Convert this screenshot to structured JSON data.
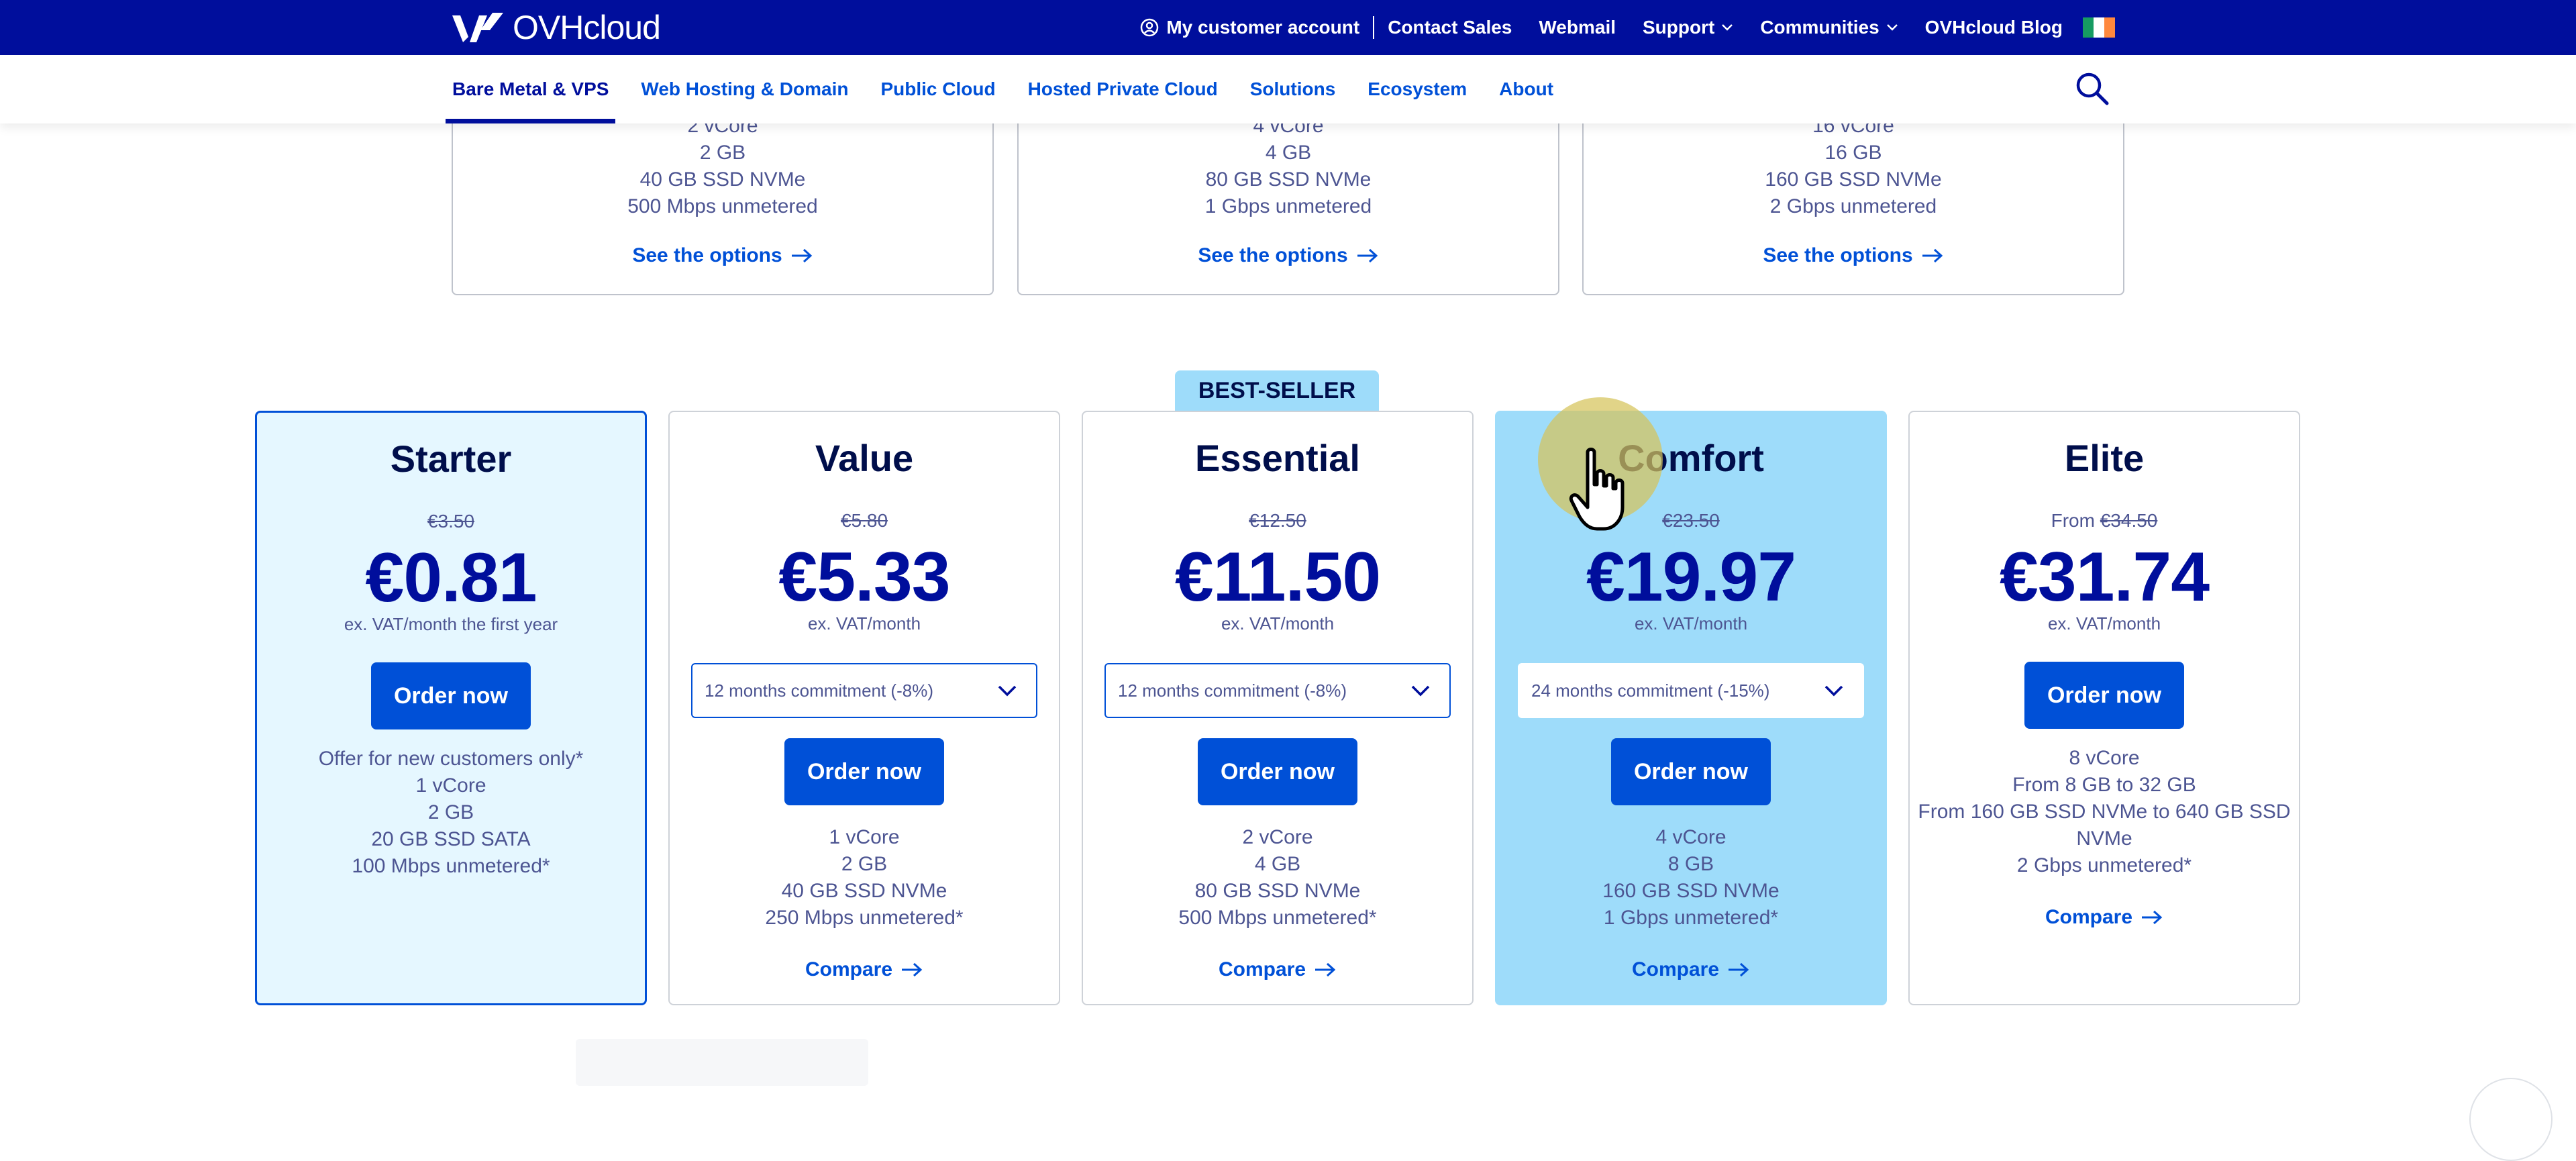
{
  "header": {
    "logo_text": "OVHcloud",
    "links": [
      {
        "label": "My customer account",
        "icon": "user-circle-icon"
      },
      {
        "label": "Contact Sales"
      },
      {
        "label": "Webmail"
      },
      {
        "label": "Support",
        "icon": "chevron-down-icon"
      },
      {
        "label": "Communities",
        "icon": "chevron-down-icon"
      },
      {
        "label": "OVHcloud Blog"
      }
    ],
    "flag": "ireland-flag-icon"
  },
  "nav": {
    "items": [
      {
        "label": "Bare Metal & VPS",
        "active": true
      },
      {
        "label": "Web Hosting & Domain"
      },
      {
        "label": "Public Cloud"
      },
      {
        "label": "Hosted Private Cloud"
      },
      {
        "label": "Solutions"
      },
      {
        "label": "Ecosystem"
      },
      {
        "label": "About"
      }
    ],
    "search_icon": "search-icon"
  },
  "upper_cards": [
    {
      "specs": [
        "2 vCore",
        "2 GB",
        "40 GB SSD NVMe",
        "500 Mbps unmetered"
      ],
      "link": "See the options"
    },
    {
      "specs": [
        "4 vCore",
        "4 GB",
        "80 GB SSD NVMe",
        "1 Gbps unmetered"
      ],
      "link": "See the options"
    },
    {
      "specs": [
        "16 vCore",
        "16 GB",
        "160 GB SSD NVMe",
        "2 Gbps unmetered"
      ],
      "link": "See the options"
    }
  ],
  "badge": "BEST-SELLER",
  "plans": [
    {
      "name": "Starter",
      "old_price_prefix": "",
      "old_price": "€3.50",
      "price": "€0.81",
      "price_note": "ex. VAT/month the first year",
      "commitment": "",
      "button": "Order now",
      "features": [
        "Offer for new customers only*",
        "1 vCore",
        "2 GB",
        "20 GB SSD SATA",
        "100 Mbps unmetered*"
      ],
      "compare": ""
    },
    {
      "name": "Value",
      "old_price_prefix": "",
      "old_price": "€5.80",
      "price": "€5.33",
      "price_note": "ex. VAT/month",
      "commitment": "12 months commitment (-8%)",
      "button": "Order now",
      "features": [
        "1 vCore",
        "2 GB",
        "40 GB SSD NVMe",
        "250 Mbps unmetered*"
      ],
      "compare": "Compare"
    },
    {
      "name": "Essential",
      "old_price_prefix": "",
      "old_price": "€12.50",
      "price": "€11.50",
      "price_note": "ex. VAT/month",
      "commitment": "12 months commitment (-8%)",
      "button": "Order now",
      "features": [
        "2 vCore",
        "4 GB",
        "80 GB SSD NVMe",
        "500 Mbps unmetered*"
      ],
      "compare": "Compare"
    },
    {
      "name": "Comfort",
      "old_price_prefix": "",
      "old_price": "€23.50",
      "price": "€19.97",
      "price_note": "ex. VAT/month",
      "commitment": "24 months commitment (-15%)",
      "button": "Order now",
      "features": [
        "4 vCore",
        "8 GB",
        "160 GB SSD NVMe",
        "1 Gbps unmetered*"
      ],
      "compare": "Compare"
    },
    {
      "name": "Elite",
      "old_price_prefix": "From",
      "old_price": "€34.50",
      "price": "€31.74",
      "price_note": "ex. VAT/month",
      "commitment": "",
      "button": "Order now",
      "features": [
        "8 vCore",
        "From 8 GB to 32 GB",
        "From 160 GB SSD NVMe to 640 GB SSD NVMe",
        "2 Gbps unmetered*"
      ],
      "compare": "Compare"
    }
  ],
  "colors": {
    "brand_dark": "#000e9c",
    "link_blue": "#0050d7",
    "highlight_light": "#e5f7ff",
    "highlight_best": "#9edcfa",
    "text_muted": "#4d5592"
  }
}
